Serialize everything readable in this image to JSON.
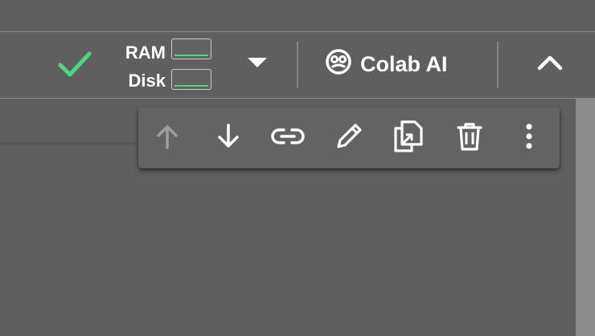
{
  "resources": {
    "ram_label": "RAM",
    "disk_label": "Disk",
    "ram_usage": 0.08,
    "disk_usage": 0.1,
    "status_color": "#4dd680"
  },
  "colab_ai": {
    "label": "Colab AI"
  },
  "icons": {
    "connected": "check-icon",
    "dropdown": "caret-down-icon",
    "colab_ai": "colab-ai-icon",
    "collapse": "chevron-up-icon"
  },
  "cell_toolbar": {
    "actions": [
      {
        "name": "move-cell-up",
        "icon": "arrow-up-icon",
        "enabled": false
      },
      {
        "name": "move-cell-down",
        "icon": "arrow-down-icon",
        "enabled": true
      },
      {
        "name": "copy-link",
        "icon": "link-icon",
        "enabled": true
      },
      {
        "name": "edit-cell",
        "icon": "pencil-icon",
        "enabled": true
      },
      {
        "name": "copy-to-tab",
        "icon": "mirror-cell-icon",
        "enabled": true
      },
      {
        "name": "delete-cell",
        "icon": "trash-icon",
        "enabled": true
      },
      {
        "name": "more-actions",
        "icon": "more-vert-icon",
        "enabled": true
      }
    ]
  },
  "colors": {
    "background": "#5f5f5f",
    "icon": "#ffffff",
    "icon_disabled": "#9e9e9e",
    "accent_green": "#4dd680"
  }
}
